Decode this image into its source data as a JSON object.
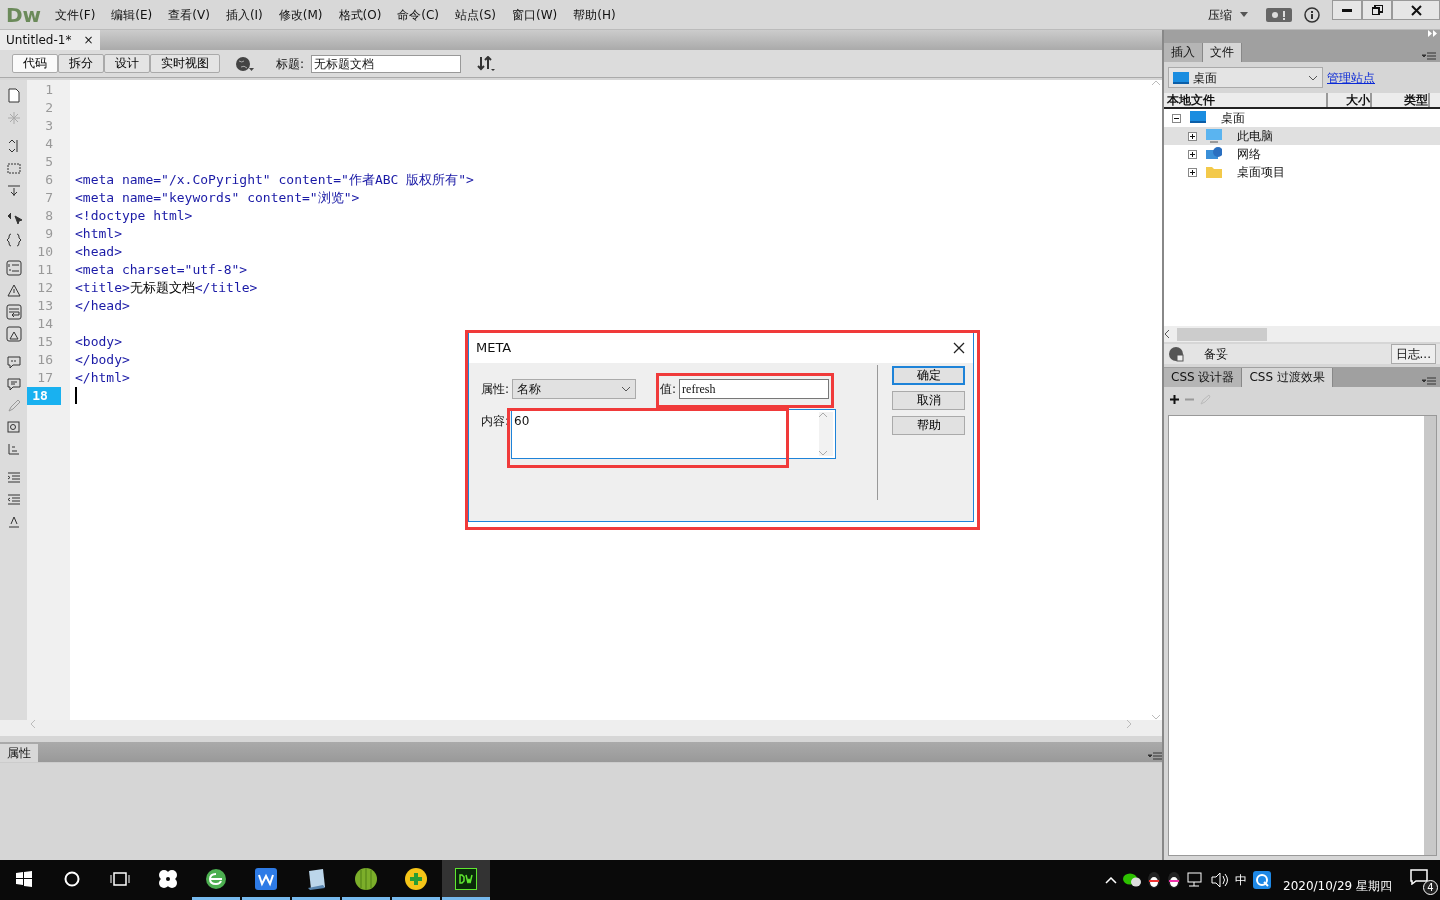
{
  "app": {
    "logo": "Dw",
    "menu": [
      "文件(F)",
      "编辑(E)",
      "查看(V)",
      "插入(I)",
      "修改(M)",
      "格式(O)",
      "命令(C)",
      "站点(S)",
      "窗口(W)",
      "帮助(H)"
    ],
    "compress": "压缩"
  },
  "document_tab": {
    "title": "Untitled-1*",
    "close": "×"
  },
  "view_buttons": [
    {
      "label": "代码",
      "selected": true
    },
    {
      "label": "拆分",
      "selected": false
    },
    {
      "label": "设计",
      "selected": false
    },
    {
      "label": "实时视图",
      "selected": false
    }
  ],
  "title_field": {
    "label": "标题:",
    "value": "无标题文档"
  },
  "code_lines": [
    {
      "number": "1",
      "current": false
    },
    {
      "number": "2",
      "current": false
    },
    {
      "number": "3",
      "current": false
    },
    {
      "number": "4",
      "current": false
    },
    {
      "number": "5",
      "current": false
    },
    {
      "number": "6",
      "current": false,
      "segments": [
        {
          "kind": "tag",
          "text": "<meta name=\"/x.CoPyright\" content=\"作者ABC 版权所有\">"
        }
      ]
    },
    {
      "number": "7",
      "current": false,
      "segments": [
        {
          "kind": "tag",
          "text": "<meta name=\"keywords\" content=\"浏览\">"
        }
      ]
    },
    {
      "number": "8",
      "current": false,
      "segments": [
        {
          "kind": "tag",
          "text": "<!doctype html>"
        }
      ]
    },
    {
      "number": "9",
      "current": false,
      "segments": [
        {
          "kind": "tag",
          "text": "<html>"
        }
      ]
    },
    {
      "number": "10",
      "current": false,
      "segments": [
        {
          "kind": "tag",
          "text": "<head>"
        }
      ]
    },
    {
      "number": "11",
      "current": false,
      "segments": [
        {
          "kind": "tag",
          "text": "<meta charset=\"utf-8\">"
        }
      ]
    },
    {
      "number": "12",
      "current": false,
      "segments": [
        {
          "kind": "tag",
          "text": "<title>"
        },
        {
          "kind": "text",
          "text": "无标题文档"
        },
        {
          "kind": "tag",
          "text": "</title>"
        }
      ]
    },
    {
      "number": "13",
      "current": false,
      "segments": [
        {
          "kind": "tag",
          "text": "</head>"
        }
      ]
    },
    {
      "number": "14",
      "current": false
    },
    {
      "number": "15",
      "current": false,
      "segments": [
        {
          "kind": "tag",
          "text": "<body>"
        }
      ]
    },
    {
      "number": "16",
      "current": false,
      "segments": [
        {
          "kind": "tag",
          "text": "</body>"
        }
      ]
    },
    {
      "number": "17",
      "current": false,
      "segments": [
        {
          "kind": "tag",
          "text": "</html>"
        }
      ]
    },
    {
      "number": "18",
      "current": true
    }
  ],
  "properties_panel": {
    "title": "属性"
  },
  "files_panel": {
    "tabs": [
      {
        "label": "插入",
        "selected": false
      },
      {
        "label": "文件",
        "selected": true
      }
    ],
    "location": "桌面",
    "manage_link": "管理站点",
    "columns": [
      "本地文件",
      "大小",
      "类型"
    ],
    "tree": [
      {
        "label": "桌面",
        "kind": "desktop",
        "expanded": true,
        "selected": false,
        "children": [
          {
            "label": "此电脑",
            "kind": "computer",
            "expanded": false,
            "selected": true
          },
          {
            "label": "网络",
            "kind": "network",
            "expanded": false,
            "selected": false
          },
          {
            "label": "桌面项目",
            "kind": "folder",
            "expanded": false,
            "selected": false
          }
        ]
      }
    ],
    "status": "备妥",
    "log_button": "日志..."
  },
  "css_panel": {
    "tabs": [
      {
        "label": "CSS 设计器",
        "selected": false
      },
      {
        "label": "CSS 过渡效果",
        "selected": true
      }
    ]
  },
  "dialog": {
    "title": "META",
    "attribute_label": "属性:",
    "attribute_value": "名称",
    "value_label": "值:",
    "value": "refresh",
    "content_label": "内容:",
    "content": "60",
    "buttons": [
      {
        "label": "确定",
        "selected": true
      },
      {
        "label": "取消",
        "selected": false
      },
      {
        "label": "帮助",
        "selected": false
      }
    ]
  },
  "taskbar": {
    "apps": [
      {
        "kind": "browser",
        "selected": false
      },
      {
        "kind": "writer",
        "selected": false
      },
      {
        "kind": "notepad",
        "selected": false
      },
      {
        "kind": "melon",
        "selected": false
      },
      {
        "kind": "plus",
        "selected": false
      },
      {
        "kind": "dw",
        "selected": true
      }
    ],
    "ime": "中",
    "date": "2020/10/29 星期四",
    "notifications": "4"
  }
}
